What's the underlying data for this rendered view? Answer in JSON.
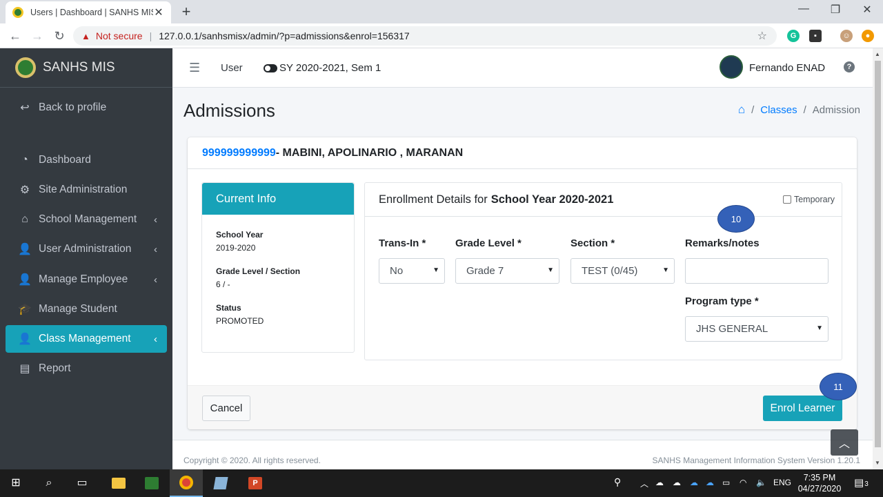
{
  "browser": {
    "tab_title": "Users | Dashboard | SANHS MIS",
    "not_secure": "Not secure",
    "url": "127.0.0.1/sanhsmisx/admin/?p=admissions&enrol=156317"
  },
  "sidebar": {
    "brand": "SANHS MIS",
    "back": "Back to profile",
    "items": [
      {
        "label": "Dashboard"
      },
      {
        "label": "Site Administration"
      },
      {
        "label": "School Management"
      },
      {
        "label": "User Administration"
      },
      {
        "label": "Manage Employee"
      },
      {
        "label": "Manage Student"
      },
      {
        "label": "Class Management"
      },
      {
        "label": "Report"
      }
    ]
  },
  "topnav": {
    "user_link": "User",
    "school_year": "SY 2020-2021, Sem 1",
    "username": "Fernando ENAD"
  },
  "page": {
    "title": "Admissions",
    "breadcrumb": {
      "classes": "Classes",
      "current": "Admission"
    }
  },
  "student": {
    "lrn": "999999999999",
    "name": " - MABINI, APOLINARIO , MARANAN"
  },
  "current_info": {
    "header": "Current Info",
    "school_year_label": "School Year",
    "school_year": "2019-2020",
    "grade_label": "Grade Level / Section",
    "grade": "6 / -",
    "status_label": "Status",
    "status": "PROMOTED"
  },
  "enrollment": {
    "header_prefix": "Enrollment Details for",
    "header_year": "School Year 2020-2021",
    "temporary": "Temporary",
    "trans_in_label": "Trans-In *",
    "trans_in_value": "No",
    "grade_level_label": "Grade Level *",
    "grade_level_value": "Grade 7",
    "section_label": "Section *",
    "section_value": "TEST (0/45)",
    "remarks_label": "Remarks/notes",
    "remarks_value": "",
    "program_label": "Program type *",
    "program_value": "JHS GENERAL"
  },
  "actions": {
    "cancel": "Cancel",
    "enrol": "Enrol Learner"
  },
  "markers": {
    "m10": "10",
    "m11": "11"
  },
  "footer": {
    "copyright": "Copyright © 2020. All rights reserved.",
    "version": "SANHS Management Information System Version 1.20.1"
  },
  "taskbar": {
    "lang": "ENG",
    "time": "7:35 PM",
    "date": "04/27/2020",
    "notif_count": "3"
  },
  "colors": {
    "accent": "#17a2b8",
    "sidebar": "#343a40",
    "link": "#007bff",
    "marker": "#3461b8"
  }
}
